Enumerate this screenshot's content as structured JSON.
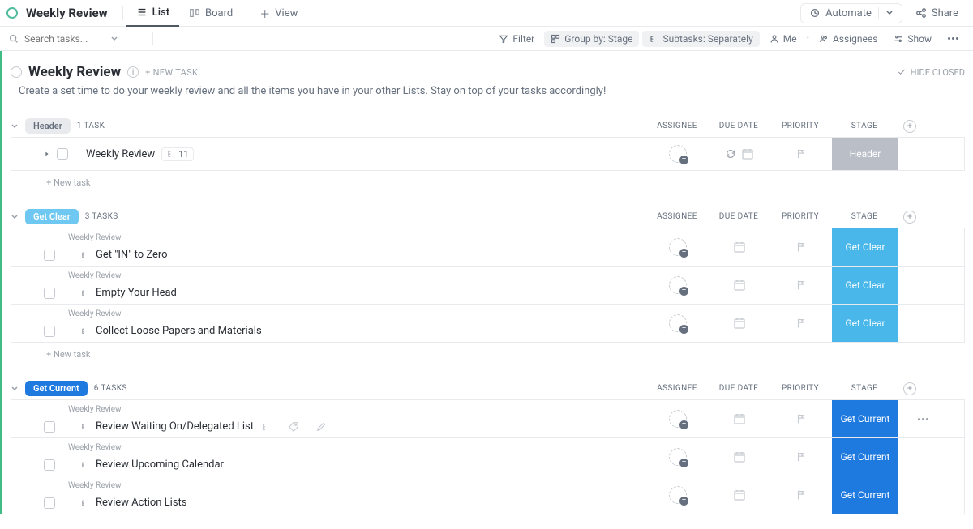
{
  "header": {
    "title": "Weekly Review",
    "views": {
      "list": "List",
      "board": "Board",
      "add": "View"
    },
    "automate": "Automate",
    "share": "Share"
  },
  "toolbar": {
    "search_placeholder": "Search tasks...",
    "filter": "Filter",
    "group_by": "Group by: Stage",
    "subtasks": "Subtasks: Separately",
    "me": "Me",
    "assignees": "Assignees",
    "show": "Show"
  },
  "page": {
    "title": "Weekly Review",
    "new_task": "+ NEW TASK",
    "hide_closed": "HIDE CLOSED",
    "description": "Create a set time to do your weekly review and all the items you have in your other Lists. Stay on top of your tasks accordingly!",
    "add_task": "+ New task"
  },
  "columns": {
    "assignee": "ASSIGNEE",
    "due": "DUE DATE",
    "priority": "PRIORITY",
    "stage": "STAGE"
  },
  "groups": [
    {
      "id": "header",
      "label": "Header",
      "count_label": "1 TASK",
      "pill_bg": "#e8eaed",
      "pill_fg": "#656f7d",
      "stage_bg": "#b9bec7",
      "tasks": [
        {
          "name": "Weekly Review",
          "subcount": "11",
          "has_recur": true,
          "crumb": "",
          "stage_label": "Header"
        }
      ],
      "show_add": true
    },
    {
      "id": "get-clear",
      "label": "Get Clear",
      "count_label": "3 TASKS",
      "pill_bg": "#6fc8f1",
      "pill_fg": "#ffffff",
      "stage_bg": "#49b7ea",
      "tasks": [
        {
          "name": "Get \"IN\" to Zero",
          "crumb": "Weekly Review",
          "stage_label": "Get Clear"
        },
        {
          "name": "Empty Your Head",
          "crumb": "Weekly Review",
          "stage_label": "Get Clear"
        },
        {
          "name": "Collect Loose Papers and Materials",
          "crumb": "Weekly Review",
          "stage_label": "Get Clear"
        }
      ],
      "show_add": true
    },
    {
      "id": "get-current",
      "label": "Get Current",
      "count_label": "6 TASKS",
      "pill_bg": "#1f7ae0",
      "pill_fg": "#ffffff",
      "stage_bg": "#1f7ae0",
      "tasks": [
        {
          "name": "Review Waiting On/Delegated List",
          "crumb": "Weekly Review",
          "stage_label": "Get Current",
          "hover": true
        },
        {
          "name": "Review Upcoming Calendar",
          "crumb": "Weekly Review",
          "stage_label": "Get Current"
        },
        {
          "name": "Review Action Lists",
          "crumb": "Weekly Review",
          "stage_label": "Get Current"
        }
      ],
      "show_add": false
    }
  ]
}
